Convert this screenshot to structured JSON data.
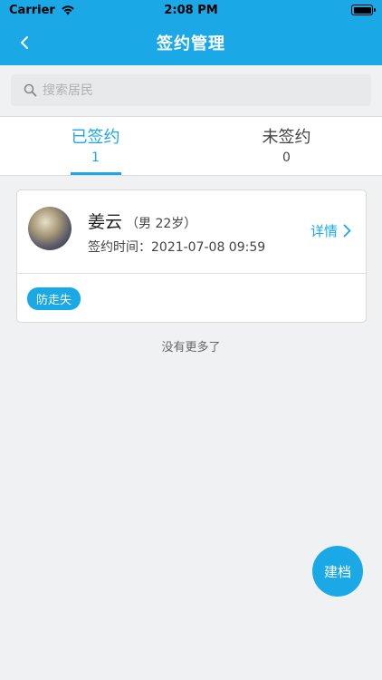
{
  "status_bar": {
    "carrier": "Carrier",
    "time": "2:08 PM",
    "icons": [
      "wifi-icon",
      "battery-icon"
    ]
  },
  "nav": {
    "title": "签约管理",
    "back_icon": "chevron-left-icon"
  },
  "search": {
    "placeholder": "搜索居民",
    "value": "",
    "icon": "search-icon"
  },
  "tabs": [
    {
      "label": "已签约",
      "count": "1",
      "active": true
    },
    {
      "label": "未签约",
      "count": "0",
      "active": false
    }
  ],
  "resident": {
    "name": "姜云",
    "meta": "（男 22岁）",
    "sign_time": "签约时间：2021-07-08 09:59",
    "detail_label": "详情",
    "tag": "防走失"
  },
  "list_footer": "没有更多了",
  "fab_label": "建档",
  "colors": {
    "accent": "#1aa9e6",
    "background": "#f0f1f3"
  }
}
